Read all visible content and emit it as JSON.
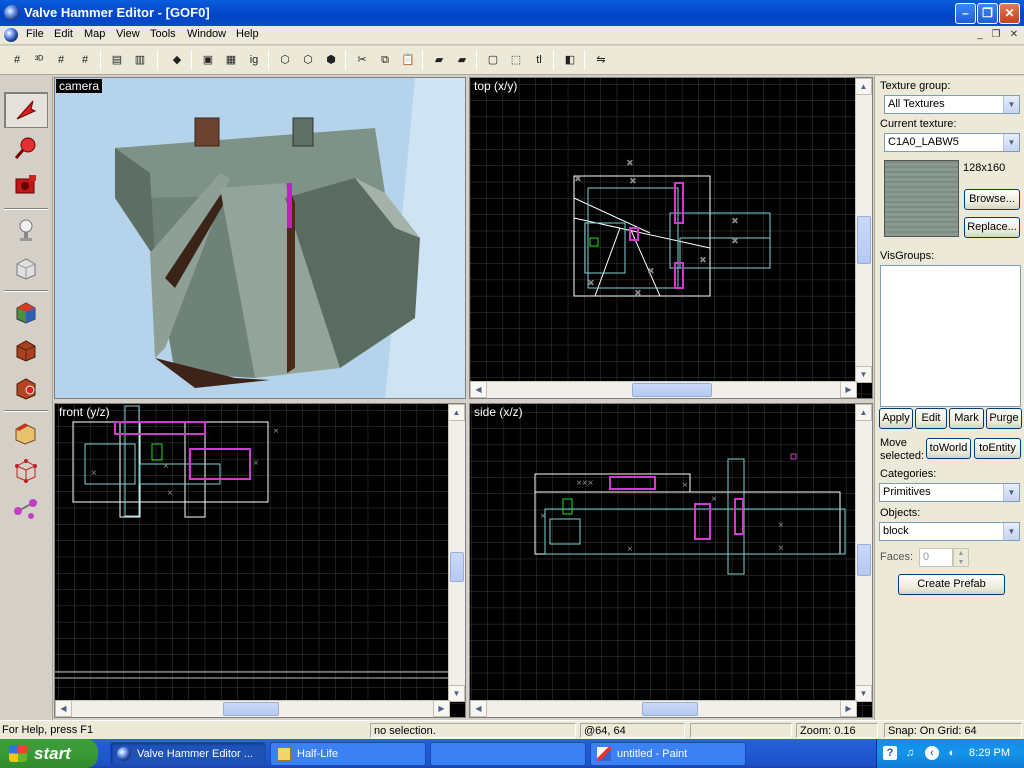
{
  "window": {
    "title": "Valve Hammer Editor - [GOF0]"
  },
  "menu": [
    "File",
    "Edit",
    "Map",
    "View",
    "Tools",
    "Window",
    "Help"
  ],
  "viewports": {
    "camera": "camera",
    "top": "top (x/y)",
    "front": "front (y/z)",
    "side": "side (x/z)"
  },
  "panel": {
    "texture_group_label": "Texture group:",
    "texture_group_value": "All Textures",
    "current_texture_label": "Current texture:",
    "current_texture_value": "C1A0_LABW5",
    "texture_size": "128x160",
    "browse": "Browse...",
    "replace": "Replace...",
    "visgroups_label": "VisGroups:",
    "apply": "Apply",
    "edit": "Edit",
    "mark": "Mark",
    "purge": "Purge",
    "move_selected_1": "Move",
    "move_selected_2": "selected:",
    "to_world": "toWorld",
    "to_entity": "toEntity",
    "categories_label": "Categories:",
    "categories_value": "Primitives",
    "objects_label": "Objects:",
    "objects_value": "block",
    "faces_label": "Faces:",
    "faces_value": "0",
    "create_prefab": "Create Prefab"
  },
  "status": {
    "help": "For Help, press F1",
    "selection": "no selection.",
    "coords": "@64, 64",
    "zoom": "Zoom: 0.16",
    "snap": "Snap: On Grid: 64"
  },
  "taskbar": {
    "start": "start",
    "tasks": [
      "Valve Hammer Editor ...",
      "Half-Life",
      "untitled - Paint"
    ],
    "clock": "8:29 PM"
  },
  "colors": {
    "grid": "#3a3a3a",
    "brush_white": "#ffffff",
    "brush_cyan": "#7fd4d4",
    "entity_magenta": "#d03ad0"
  }
}
